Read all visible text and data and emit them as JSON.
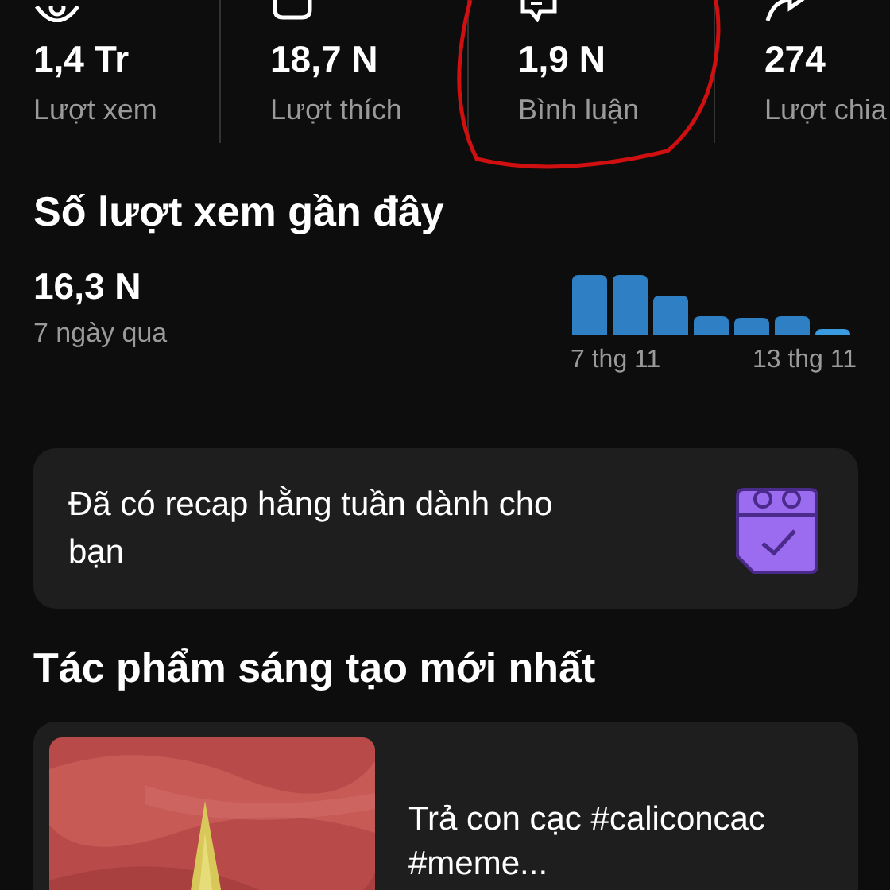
{
  "stats": [
    {
      "value": "1,4 Tr",
      "label": "Lượt xem"
    },
    {
      "value": "18,7 N",
      "label": "Lượt thích"
    },
    {
      "value": "1,9 N",
      "label": "Bình luận"
    },
    {
      "value": "274",
      "label": "Lượt chia"
    }
  ],
  "recent_views": {
    "title": "Số lượt xem gần đây",
    "total": "16,3 N",
    "period": "7 ngày qua",
    "axis_start": "7 thg 11",
    "axis_end": "13 thg 11"
  },
  "recap": {
    "text": "Đã có recap hằng tuần dành cho bạn"
  },
  "latest": {
    "title": "Tác phẩm sáng tạo mới nhất",
    "item": {
      "kind": "picture",
      "caption": "Trả con cạc #caliconcac #meme..."
    }
  }
}
